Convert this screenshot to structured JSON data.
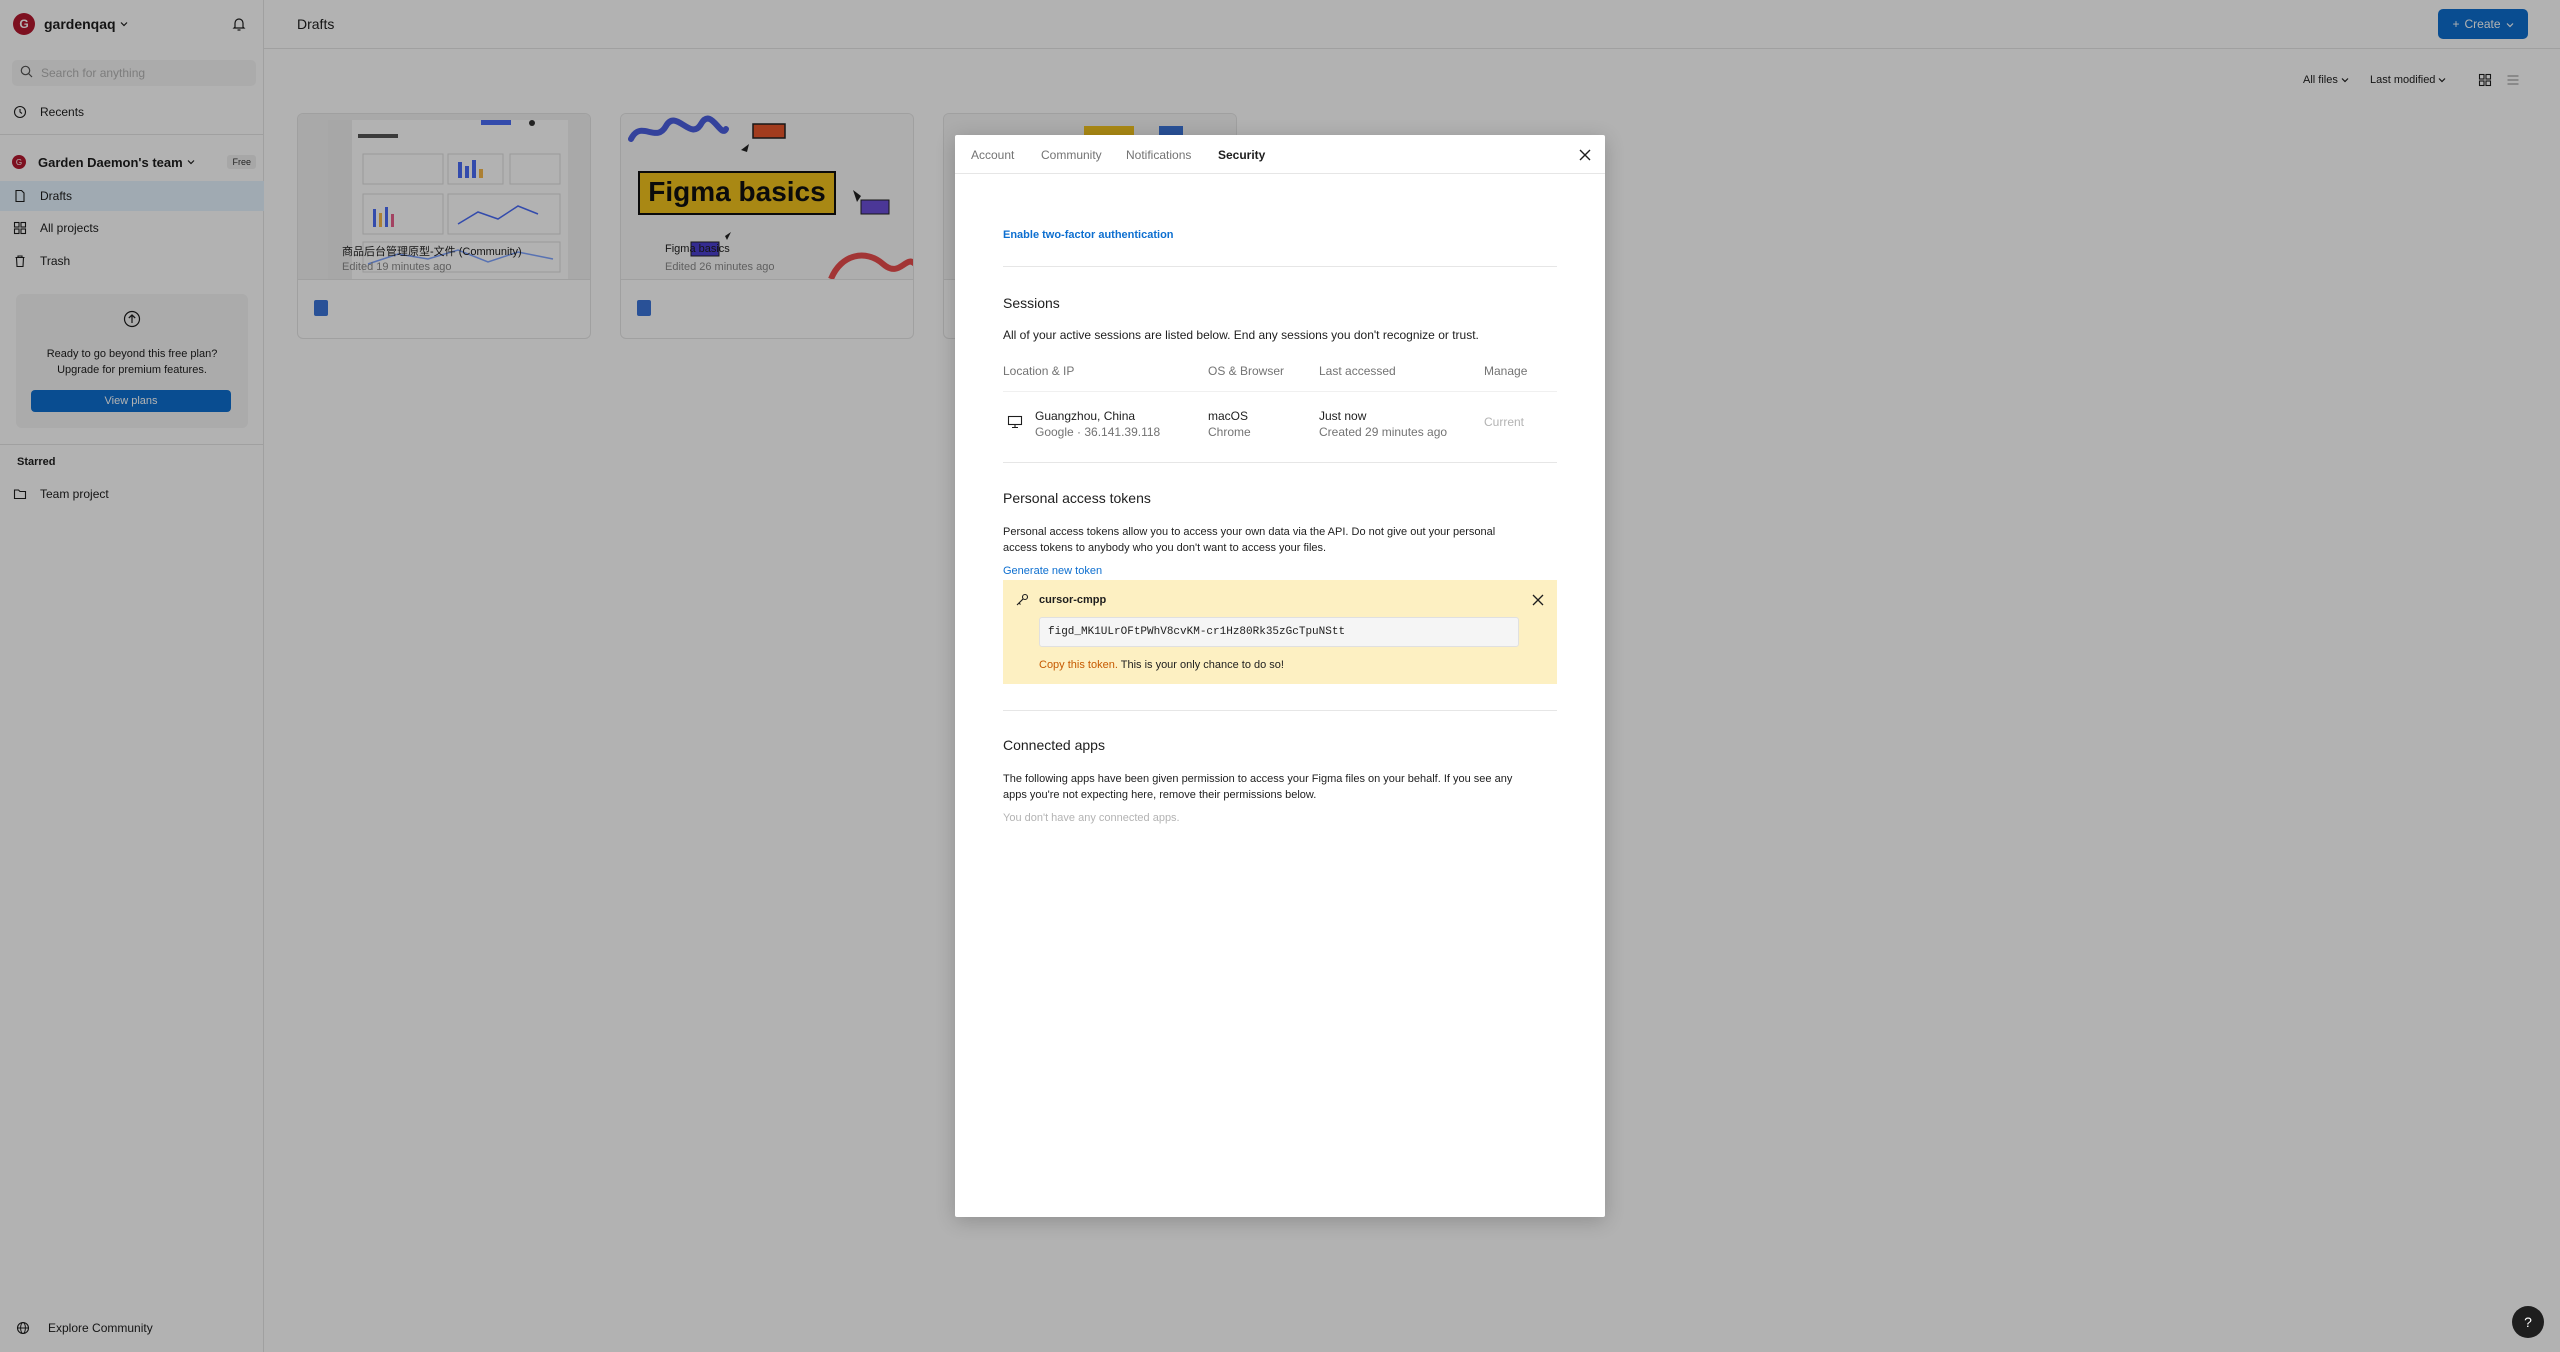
{
  "user": {
    "avatar_letter": "G",
    "name": "gardenqaq"
  },
  "search": {
    "placeholder": "Search for anything"
  },
  "sidebar": {
    "recents": "Recents",
    "team": {
      "initial": "G",
      "name": "Garden Daemon's team",
      "badge": "Free"
    },
    "items": [
      {
        "label": "Drafts",
        "active": true
      },
      {
        "label": "All projects",
        "active": false
      },
      {
        "label": "Trash",
        "active": false
      }
    ],
    "upgrade": {
      "text_line1": "Ready to go beyond this free plan?",
      "text_line2": "Upgrade for premium features.",
      "button": "View plans"
    },
    "starred_heading": "Starred",
    "starred_items": [
      {
        "label": "Team project"
      }
    ],
    "explore": "Explore Community"
  },
  "header": {
    "title": "Drafts",
    "create_label": "Create"
  },
  "filters": {
    "files": "All files",
    "sort": "Last modified"
  },
  "files": [
    {
      "title": "商品后台管理原型-文件 (Community)",
      "edited": "Edited 19 minutes ago"
    },
    {
      "title": "Figma basics",
      "edited": "Edited 26 minutes ago",
      "thumb_text": "Figma basics"
    }
  ],
  "modal": {
    "tabs": [
      "Account",
      "Community",
      "Notifications",
      "Security"
    ],
    "active_tab": "Security",
    "two_factor_link": "Enable two-factor authentication",
    "sessions": {
      "heading": "Sessions",
      "description": "All of your active sessions are listed below. End any sessions you don't recognize or trust.",
      "columns": [
        "Location & IP",
        "OS & Browser",
        "Last accessed",
        "Manage"
      ],
      "rows": [
        {
          "location": "Guangzhou, China",
          "ip": "Google · 36.141.39.118",
          "os": "macOS",
          "browser": "Chrome",
          "last": "Just now",
          "created": "Created 29 minutes ago",
          "manage": "Current"
        }
      ]
    },
    "tokens": {
      "heading": "Personal access tokens",
      "description_line1": "Personal access tokens allow you to access your own data via the API. Do not give out your personal",
      "description_line2": "access tokens to anybody who you don't want to access your files.",
      "generate_link": "Generate new token",
      "token_name": "cursor-cmpp",
      "token_value": "figd_MK1ULrOFtPWhV8cvKM-cr1Hz80Rk35zGcTpuNStt",
      "warn_orange": "Copy this token.",
      "warn_rest": " This is your only chance to do so!"
    },
    "apps": {
      "heading": "Connected apps",
      "description_line1": "The following apps have been given permission to access your Figma files on your behalf. If you see any",
      "description_line2": "apps you're not expecting here, remove their permissions below.",
      "empty": "You don't have any connected apps."
    }
  },
  "help": "?"
}
